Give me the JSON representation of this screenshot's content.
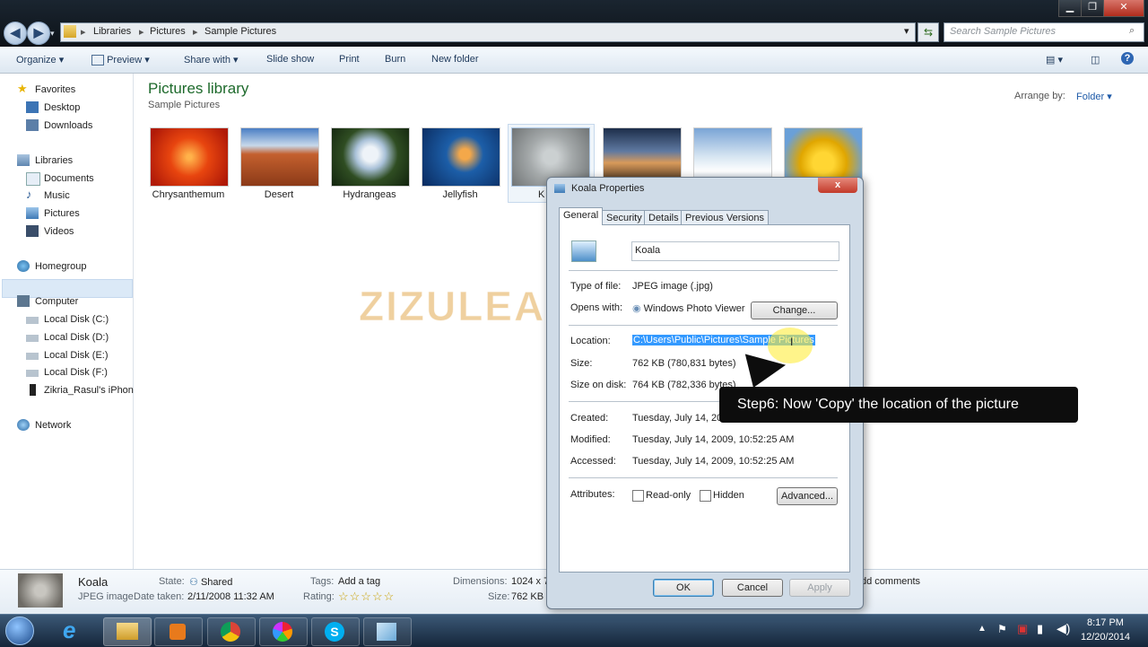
{
  "address": {
    "crumbs": [
      "Libraries",
      "Pictures",
      "Sample Pictures"
    ],
    "search_placeholder": "Search Sample Pictures"
  },
  "toolbar": {
    "organize": "Organize",
    "preview": "Preview",
    "share_with": "Share with",
    "slide_show": "Slide show",
    "print": "Print",
    "burn": "Burn",
    "new_folder": "New folder"
  },
  "nav": {
    "favorites": "Favorites",
    "desktop": "Desktop",
    "downloads": "Downloads",
    "libraries": "Libraries",
    "documents": "Documents",
    "music": "Music",
    "pictures": "Pictures",
    "videos": "Videos",
    "homegroup": "Homegroup",
    "computer": "Computer",
    "disk_c": "Local Disk (C:)",
    "disk_d": "Local Disk (D:)",
    "disk_e": "Local Disk (E:)",
    "disk_f": "Local Disk (F:)",
    "iphone": "Zikria_Rasul's iPhon",
    "network": "Network"
  },
  "library": {
    "title": "Pictures library",
    "subtitle": "Sample Pictures",
    "arrange_label": "Arrange by:",
    "arrange_value": "Folder"
  },
  "pictures": [
    {
      "name": "Chrysanthemum"
    },
    {
      "name": "Desert"
    },
    {
      "name": "Hydrangeas"
    },
    {
      "name": "Jellyfish"
    },
    {
      "name": "K"
    }
  ],
  "details": {
    "name": "Koala",
    "type": "JPEG image",
    "state_label": "State:",
    "state_value": "Shared",
    "date_label": "Date taken:",
    "date_value": "2/11/2008 11:32 AM",
    "tags_label": "Tags:",
    "tags_value": "Add a tag",
    "rating_label": "Rating:",
    "rating_stars": "☆☆☆☆☆",
    "dimensions_label": "Dimensions:",
    "dimensions_value": "1024 x 7",
    "size_label": "Size:",
    "size_value": "762 KB",
    "comments": "dd comments"
  },
  "dialog": {
    "title": "Koala Properties",
    "close": "x",
    "tabs": [
      "General",
      "Security",
      "Details",
      "Previous Versions"
    ],
    "file_name": "Koala",
    "type_label": "Type of file:",
    "type_value": "JPEG image (.jpg)",
    "opens_label": "Opens with:",
    "opens_value": "Windows Photo Viewer",
    "change_button": "Change...",
    "location_label": "Location:",
    "location_value": "C:\\Users\\Public\\Pictures\\Sample Pictures",
    "size_label": "Size:",
    "size_value": "762 KB (780,831 bytes)",
    "size_disk_label": "Size on disk:",
    "size_disk_value": "764 KB (782,336 bytes)",
    "created_label": "Created:",
    "created_value": "Tuesday, July 14, 200",
    "modified_label": "Modified:",
    "modified_value": "Tuesday, July 14, 2009, 10:52:25 AM",
    "accessed_label": "Accessed:",
    "accessed_value": "Tuesday, July 14, 2009, 10:52:25 AM",
    "attributes_label": "Attributes:",
    "readonly_label": "Read-only",
    "hidden_label": "Hidden",
    "advanced_button": "Advanced...",
    "ok_button": "OK",
    "cancel_button": "Cancel",
    "apply_button": "Apply"
  },
  "callout": "Step6: Now 'Copy' the location of the picture",
  "watermark": "ZIZULEARN.com",
  "clock": {
    "time": "8:17 PM",
    "date": "12/20/2014"
  },
  "colors": {
    "title_green": "#1e6a2c",
    "selection_blue": "#3399ff",
    "callout_bg": "#0d0d0d"
  }
}
